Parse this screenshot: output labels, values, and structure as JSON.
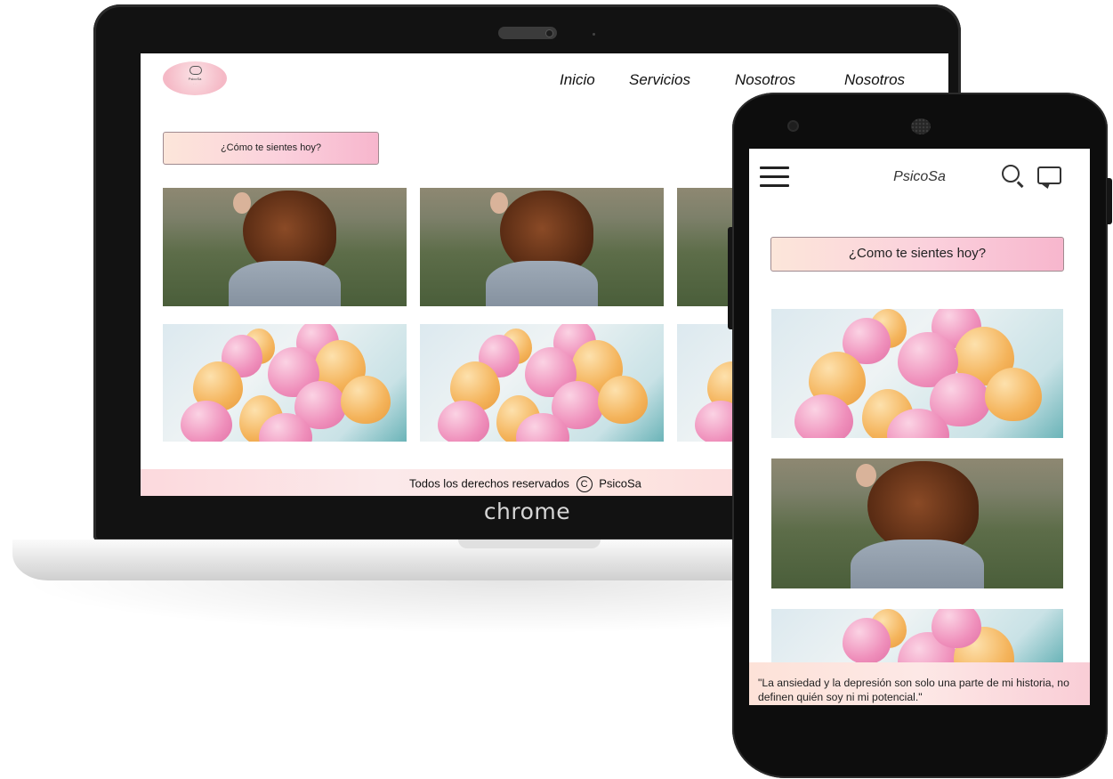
{
  "laptop": {
    "brand_label": "chrome",
    "site": {
      "logo": {
        "name": "PsicoSa",
        "tagline": "· ·"
      },
      "nav": [
        "Inicio",
        "Servicios",
        "Nosotros",
        "Nosotros"
      ],
      "mood_button": "¿Cómo te sientes hoy?",
      "footer": {
        "text": "Todos los derechos reservados",
        "copyright_symbol": "C",
        "brand": "PsicoSa"
      }
    }
  },
  "phone": {
    "site": {
      "brand": "PsicoSa",
      "icons": [
        "menu-icon",
        "search-icon",
        "chat-icon"
      ],
      "mood_button": "¿Como te sientes hoy?",
      "quote": "\"La ansiedad y la depresión son solo una parte de mi historia, no definen quién soy ni mi potencial.\""
    }
  },
  "colors": {
    "accent_pink": "#f7b6cd",
    "accent_peach": "#fce6da",
    "device_black": "#121212"
  }
}
